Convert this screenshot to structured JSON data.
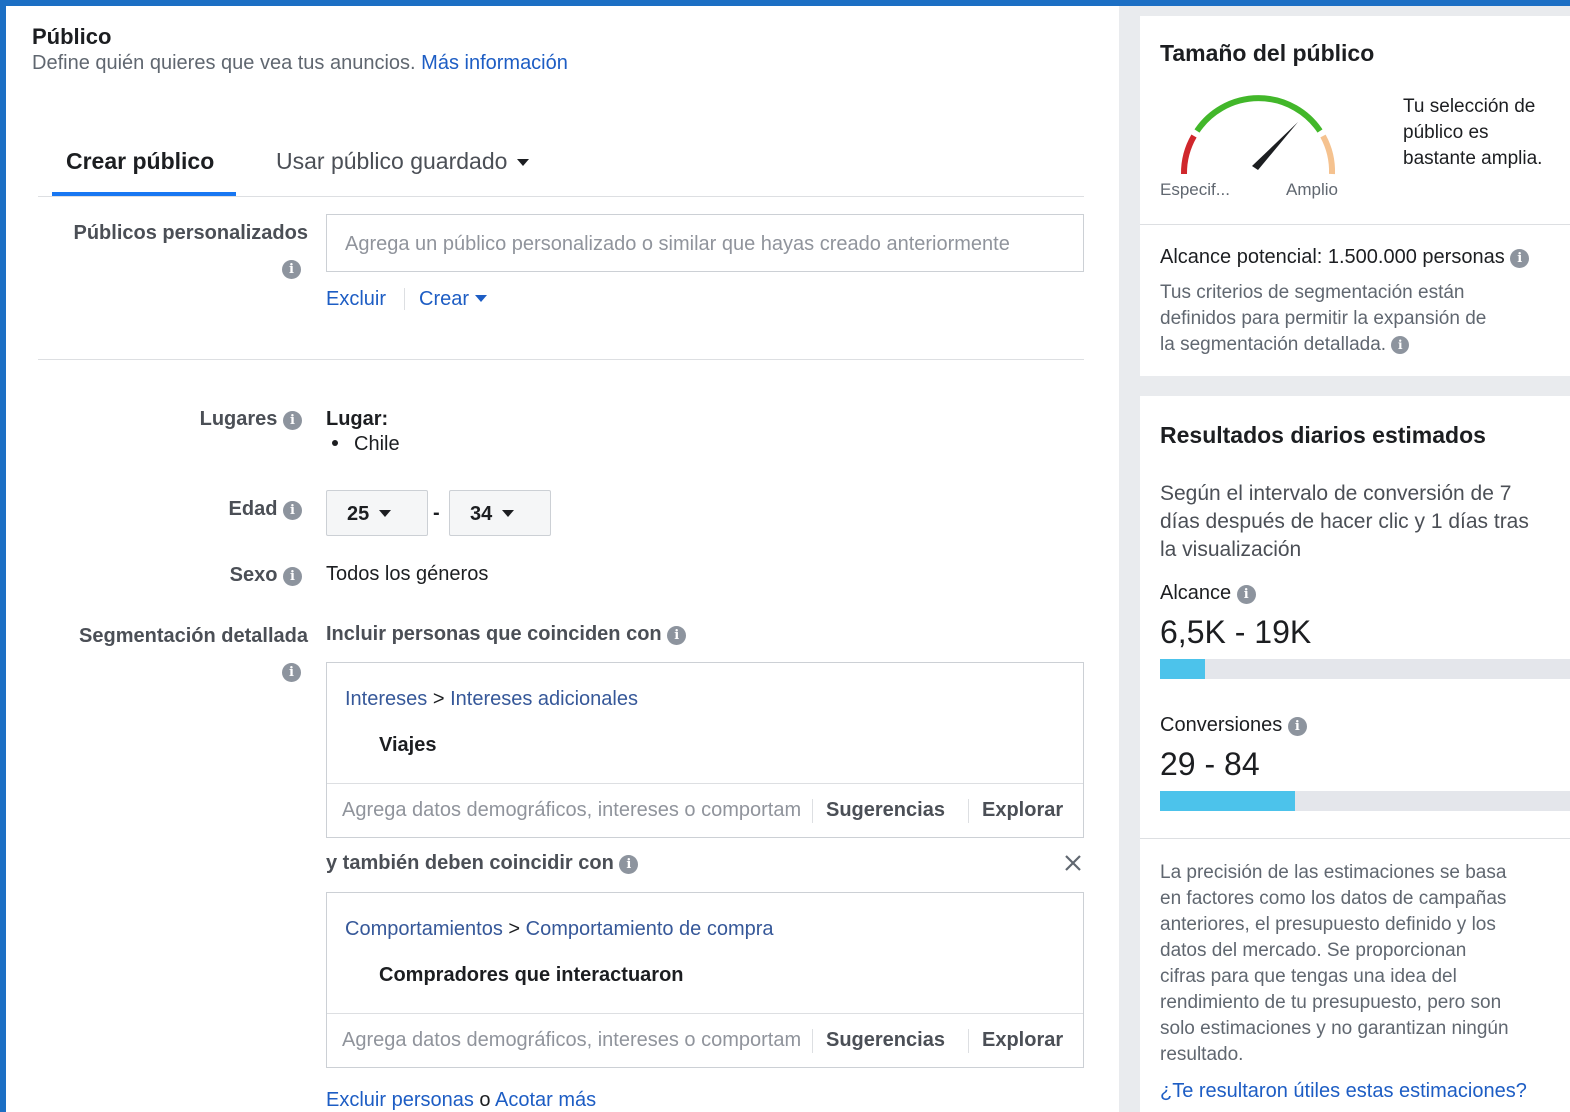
{
  "header": {
    "title": "Público",
    "subtitle": "Define quién quieres que vea tus anuncios.",
    "more_info_link": "Más información"
  },
  "tabs": [
    {
      "label": "Crear público",
      "active": true
    },
    {
      "label": "Usar público guardado",
      "active": false
    }
  ],
  "custom_audiences": {
    "label": "Públicos personalizados",
    "placeholder": "Agrega un público personalizado o similar que hayas creado anteriormente",
    "exclude_link": "Excluir",
    "create_link": "Crear"
  },
  "locations": {
    "label": "Lugares",
    "heading": "Lugar:",
    "items": [
      "Chile"
    ]
  },
  "age": {
    "label": "Edad",
    "min": "25",
    "max": "34",
    "separator": "-"
  },
  "gender": {
    "label": "Sexo",
    "value": "Todos los géneros"
  },
  "detailed_targeting": {
    "label": "Segmentación detallada",
    "include_heading": "Incluir personas que coinciden con",
    "group1": {
      "path_1": "Intereses",
      "path_sep": ">",
      "path_2": "Intereses adicionales",
      "item": "Viajes",
      "search_placeholder": "Agrega datos demográficos, intereses o comportamientos",
      "suggestions": "Sugerencias",
      "explore": "Explorar"
    },
    "narrow_heading": "y también deben coincidir con",
    "group2": {
      "path_1": "Comportamientos",
      "path_sep": ">",
      "path_2": "Comportamiento de compra",
      "item": "Compradores que interactuaron",
      "search_placeholder": "Agrega datos demográficos, intereses o comportamientos",
      "suggestions": "Sugerencias",
      "explore": "Explorar"
    },
    "exclude_people": "Excluir personas",
    "or_word": "o",
    "narrow_more": "Acotar más"
  },
  "audience_size": {
    "title": "Tamaño del público",
    "gauge_left": "Especif...",
    "gauge_right": "Amplio",
    "selection_text": [
      "Tu selección de",
      "público es",
      "bastante amplia."
    ],
    "potential_reach": "Alcance potencial: 1.500.000 personas",
    "criteria_text": [
      "Tus criterios de segmentación están",
      "definidos para permitir la expansión de",
      "la segmentación detallada."
    ]
  },
  "daily_results": {
    "title": "Resultados diarios estimados",
    "description": [
      "Según el intervalo de conversión de 7",
      "días después de hacer clic y 1 días tras",
      "la visualización"
    ],
    "reach_label": "Alcance",
    "reach_value": "6,5K - 19K",
    "reach_fill_pct": 11,
    "conversions_label": "Conversiones",
    "conversions_value": "29 - 84",
    "conversions_fill_pct": 33,
    "accuracy_text": [
      "La precisión de las estimaciones se basa",
      "en factores como los datos de campañas",
      "anteriores, el presupuesto definido y los",
      "datos del mercado. Se proporcionan",
      "cifras para que tengas una idea del",
      "rendimiento de tu presupuesto, pero son",
      "solo estimaciones y no garantizan ningún",
      "resultado."
    ],
    "feedback_question": "¿Te resultaron útiles estas estimaciones?"
  },
  "colors": {
    "link": "#1d5dc4",
    "bar_fill": "#4cc3eb",
    "gauge_green": "#42b72a",
    "gauge_red": "#d0272c",
    "gauge_peach": "#f5c28f",
    "frame": "#1c6fc4"
  }
}
